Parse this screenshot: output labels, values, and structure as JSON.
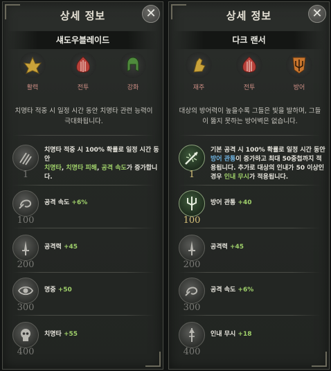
{
  "left": {
    "title": "상세 정보",
    "close": "✕",
    "class_name": "섀도우블레이드",
    "stats": [
      {
        "label": "활력",
        "icon": "lotus-icon",
        "color": "#c9a23a"
      },
      {
        "label": "전투",
        "icon": "flame-crest-icon",
        "color": "#b8413a"
      },
      {
        "label": "강화",
        "icon": "helmet-icon",
        "color": "#4f8a3c"
      }
    ],
    "description": "치명타 적중 시 일정 시간 동안 치명타 관련 능력이 극대화됩니다.",
    "perks": [
      {
        "level": "1",
        "icon": "claw-icon",
        "line1": "치명타 적중 시 100% 확률로 일정 시간 동안",
        "p1": "치명타",
        "sep1": ", ",
        "p2": "치명타 피해",
        "sep2": ", ",
        "p3": "공격 속도",
        "tail": "가 증가합니다."
      },
      {
        "level": "100",
        "icon": "swirl-icon",
        "name": "공격 속도",
        "value": "+6%"
      },
      {
        "level": "200",
        "icon": "dagger-icon",
        "name": "공격력",
        "value": "+45"
      },
      {
        "level": "300",
        "icon": "eye-icon",
        "name": "명중",
        "value": "+50"
      },
      {
        "level": "400",
        "icon": "skull-icon",
        "name": "치명타",
        "value": "+55"
      }
    ]
  },
  "right": {
    "title": "상세 정보",
    "close": "✕",
    "class_name": "다크 랜서",
    "stats": [
      {
        "label": "재주",
        "icon": "fist-icon",
        "color": "#c9a23a"
      },
      {
        "label": "전투",
        "icon": "flame-crest-icon",
        "color": "#b8413a"
      },
      {
        "label": "방어",
        "icon": "trident-crest-icon",
        "color": "#c9762e"
      }
    ],
    "description": "대상의 방어력이 높을수록 그들은 빛을 발하며, 그들이 뚫지 못하는 방어벽은 없습니다.",
    "perks": [
      {
        "level": "1",
        "icon": "spear-burst-icon",
        "line_a": "기본 공격 시 100% 확률로 일정 시간 동안",
        "h1": "방어 관통",
        "mid1": "이 증가하고 최대 50중첩까지 적용됩니다. 추가로 대상의 인내가 50 이상인 경우 ",
        "h2": "인내 무시",
        "tail": "가 적용됩니다."
      },
      {
        "level": "100",
        "icon": "trident-icon",
        "name": "방어 관통",
        "value": "+40"
      },
      {
        "level": "200",
        "icon": "dagger-icon",
        "name": "공격력",
        "value": "+45"
      },
      {
        "level": "300",
        "icon": "swirl-icon",
        "name": "공격 속도",
        "value": "+6%"
      },
      {
        "level": "400",
        "icon": "spear-icon",
        "name": "인내 무시",
        "value": "+18"
      }
    ]
  }
}
